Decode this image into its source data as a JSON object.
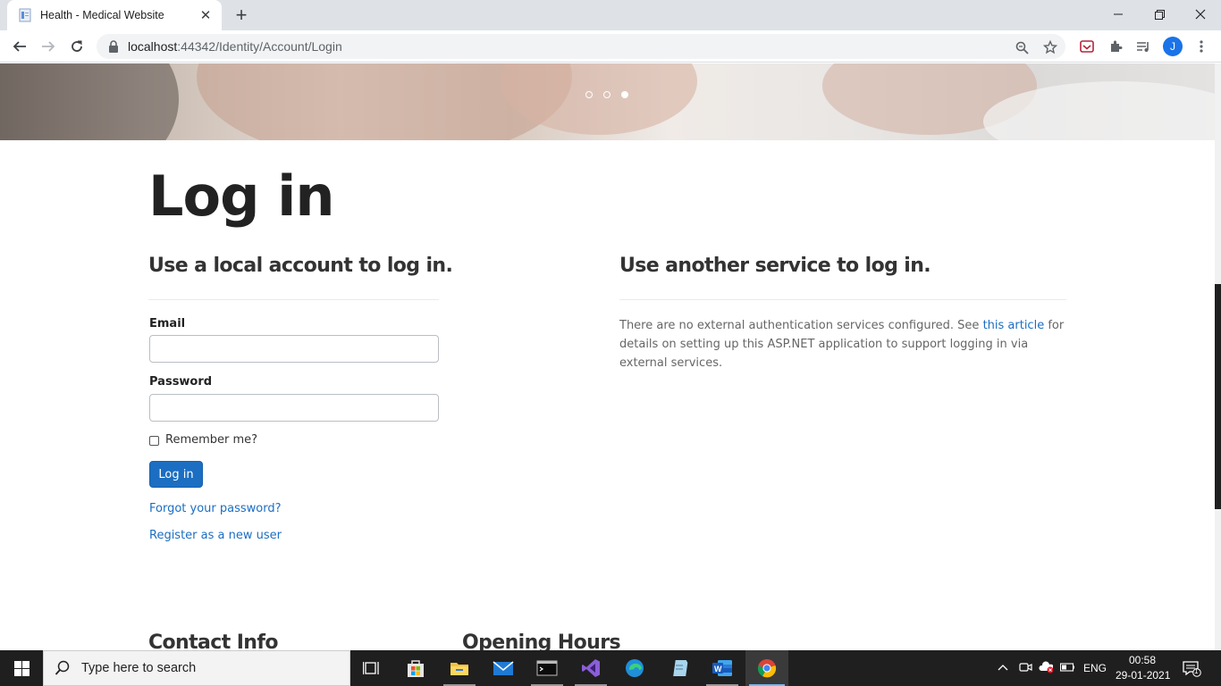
{
  "browser": {
    "tab_title": "Health - Medical Website",
    "url_host": "localhost",
    "url_rest": ":44342/Identity/Account/Login",
    "profile_initial": "J"
  },
  "carousel": {
    "slides": 3,
    "active_index": 2
  },
  "page": {
    "title": "Log in",
    "local_heading": "Use a local account to log in.",
    "external_heading": "Use another service to log in.",
    "email_label": "Email",
    "email_value": "",
    "password_label": "Password",
    "password_value": "",
    "remember_label": "Remember me?",
    "remember_checked": false,
    "login_button": "Log in",
    "forgot_link": "Forgot your password?",
    "register_link": "Register as a new user",
    "external_text_1": "There are no external authentication services configured. See ",
    "external_link": "this article",
    "external_text_2": " for details on setting up this ASP.NET application to support logging in via external services.",
    "footer_contact": "Contact Info",
    "footer_hours": "Opening Hours"
  },
  "taskbar": {
    "search_placeholder": "Type here to search",
    "language": "ENG",
    "time": "00:58",
    "date": "29-01-2021",
    "notification_count": "1"
  }
}
